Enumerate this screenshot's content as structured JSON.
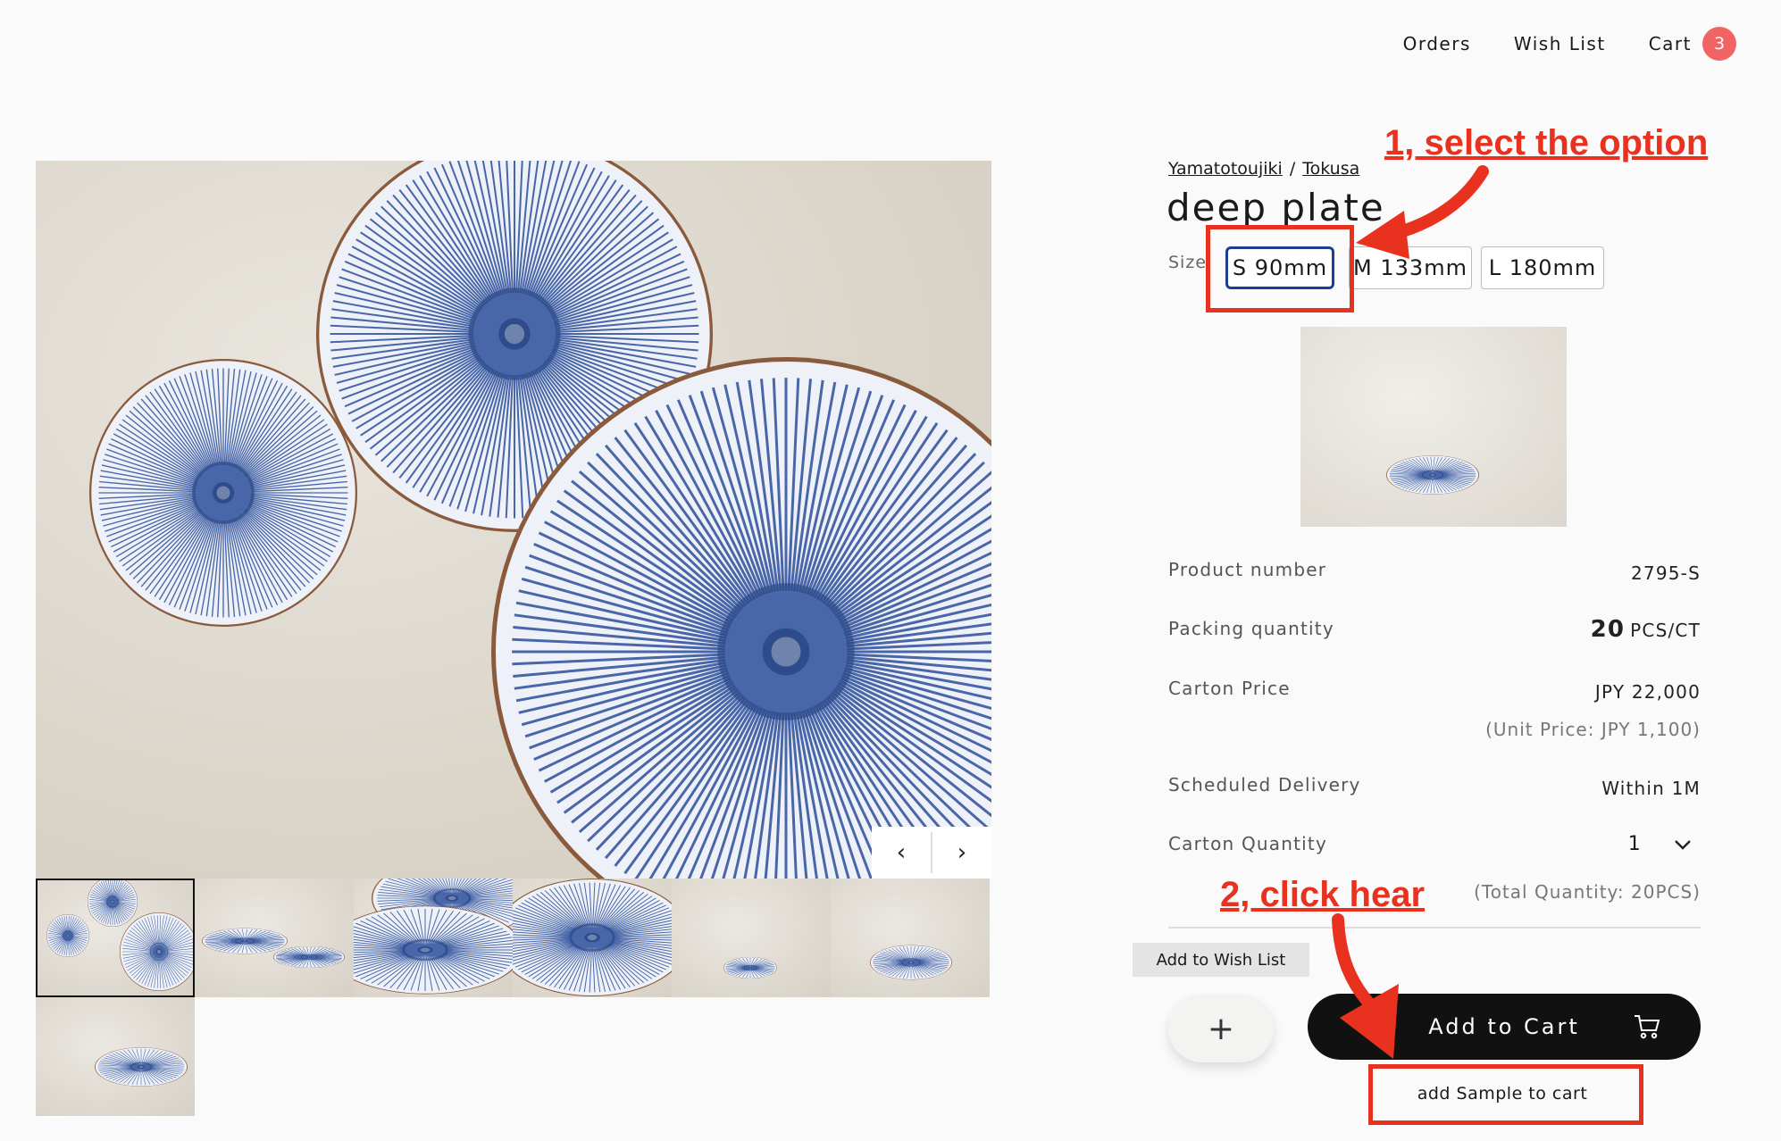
{
  "nav": {
    "orders": "Orders",
    "wishlist": "Wish List",
    "cart": "Cart",
    "cart_count": "3"
  },
  "gallery": {
    "prev_icon": "‹",
    "next_icon": "›",
    "thumbnail_count": 7,
    "active_thumbnail": 1
  },
  "product": {
    "brand": "Yamatotoujiki",
    "breadcrumb_sep": "/",
    "series": "Tokusa",
    "title": "deep plate",
    "size_label": "Size",
    "options": [
      "S 90mm",
      "M 133mm",
      "L 180mm"
    ],
    "selected_option": "S 90mm"
  },
  "specs": {
    "product_number_label": "Product number",
    "product_number": "2795-S",
    "packing_label": "Packing quantity",
    "packing_value": "20",
    "packing_unit": "PCS/CT",
    "carton_price_label": "Carton Price",
    "carton_price": "JPY 22,000",
    "unit_price": "(Unit Price: JPY 1,100)",
    "delivery_label": "Scheduled Delivery",
    "delivery": "Within 1M",
    "carton_qty_label": "Carton Quantity",
    "carton_qty": "1",
    "total_qty": "(Total Quantity: 20PCS)"
  },
  "actions": {
    "wish_tooltip": "Add to Wish List",
    "wish_plus": "+",
    "add_to_cart": "Add to Cart",
    "add_sample": "add Sample to cart"
  },
  "annotations": {
    "step1": "1, select the option",
    "step2": "2, click hear"
  },
  "colors": {
    "annotation": "#e8321f",
    "selected_border": "#1b3f93",
    "cart_badge": "#f26464",
    "plate_blue": "#2b4f9a"
  }
}
